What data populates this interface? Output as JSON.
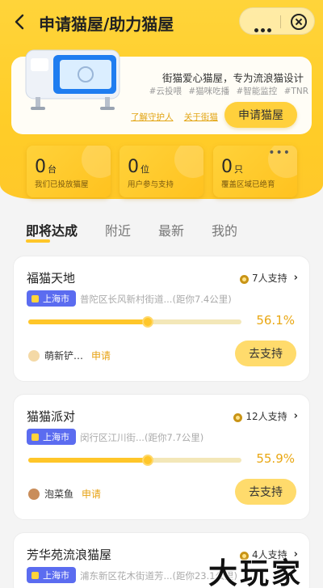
{
  "nav": {
    "title": "申请猫屋/助力猫屋"
  },
  "hero": {
    "desc": "街猫爱心猫屋，专为流浪猫设计",
    "tags": [
      "#云投喂",
      "#猫咪吃播",
      "#智能监控",
      "#TNR"
    ],
    "link_guardian": "了解守护人",
    "link_about": "关于街猫",
    "apply_label": "申请猫屋"
  },
  "stats": [
    {
      "value": "0",
      "unit": "台",
      "label": "我们已投放猫屋"
    },
    {
      "value": "0",
      "unit": "位",
      "label": "用户参与支持"
    },
    {
      "value": "0",
      "unit": "只",
      "label": "覆盖区域已绝育",
      "more": "•••"
    }
  ],
  "tabs": [
    "即将达成",
    "附近",
    "最新",
    "我的"
  ],
  "active_tab": "即将达成",
  "cards": [
    {
      "name": "福猫天地",
      "support": "7人支持",
      "city": "上海市",
      "address": "普陀区长风新村街道...(距你7.4公里)",
      "progress_pct": 56.1,
      "progress_text": "56.1%",
      "user": "萌新铲…",
      "role": "申请",
      "action": "去支持",
      "avatar_color": "#f4d9a6"
    },
    {
      "name": "猫猫派对",
      "support": "12人支持",
      "city": "上海市",
      "address": "闵行区江川街...(距你7.7公里)",
      "progress_pct": 55.9,
      "progress_text": "55.9%",
      "user": "泡菜鱼",
      "role": "申请",
      "action": "去支持",
      "avatar_color": "#c98d5a"
    },
    {
      "name": "芳华苑流浪猫屋",
      "support": "4人支持",
      "city": "上海市",
      "address": "浦东新区花木街道芳...(距你23.1公里)"
    }
  ],
  "watermark": "大玩家",
  "colors": {
    "accent": "#ffc629",
    "city_badge": "#5b6cf0",
    "percent": "#e9a713"
  }
}
